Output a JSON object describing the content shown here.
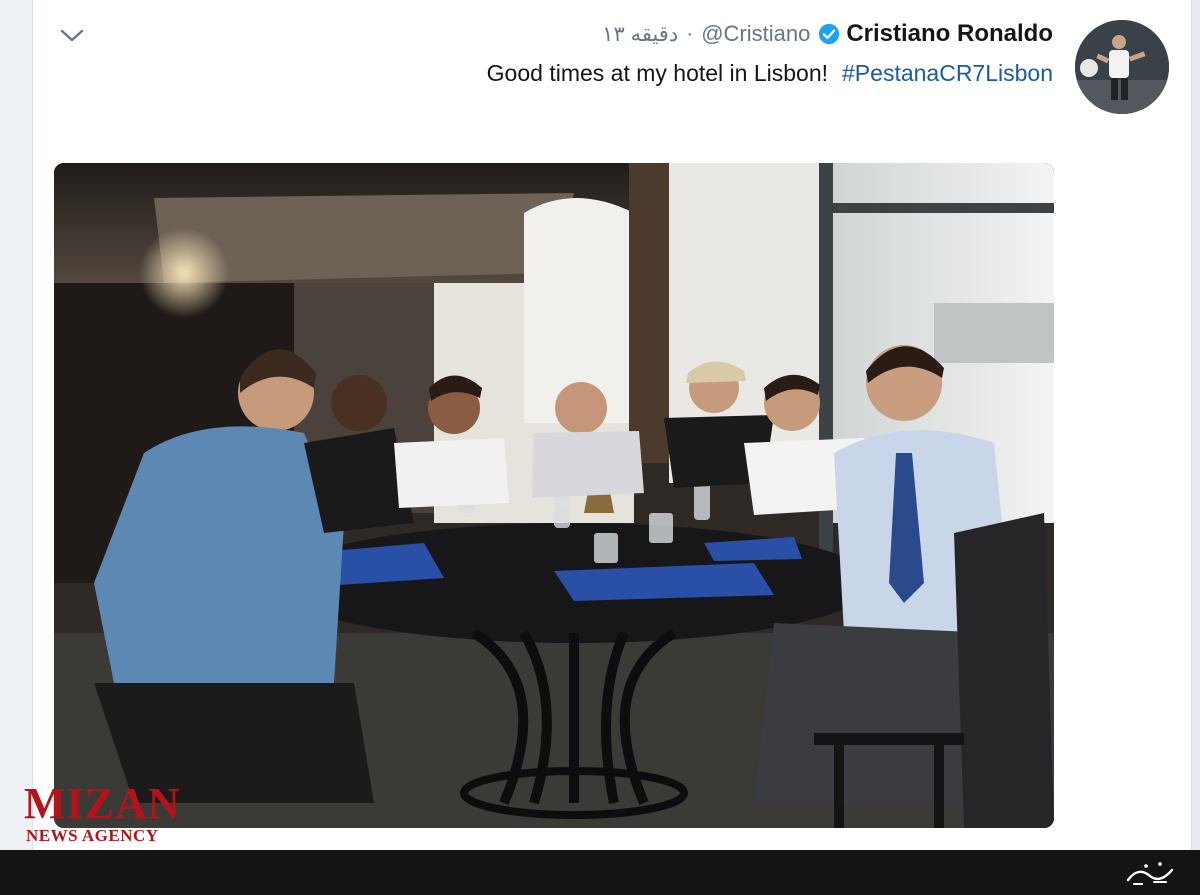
{
  "tweet": {
    "author_name": "Cristiano Ronaldo",
    "handle": "@Cristiano",
    "separator": "·",
    "time": "۱۳ دقیقه",
    "text": "Good times at my hotel in Lisbon!",
    "hashtag": "#PestanaCR7Lisbon",
    "verified": true
  },
  "icons": {
    "menu": "chevron-down-icon",
    "verified": "verified-badge-icon"
  },
  "watermark": {
    "brand": "MIZAN",
    "subtitle": "NEWS AGENCY"
  },
  "colors": {
    "name": "#14171a",
    "meta": "#657786",
    "hashtag": "#1b5aa8",
    "verified": "#1da1f2",
    "watermark": "#b3141b",
    "bottom_bar": "#141414"
  }
}
